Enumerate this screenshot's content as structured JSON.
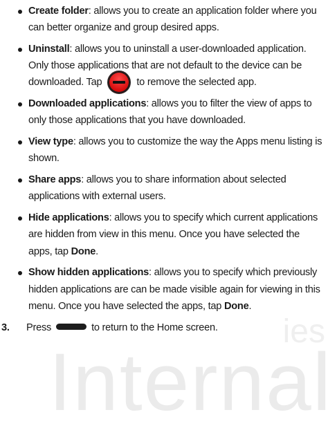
{
  "watermark": {
    "text": "Internal",
    "text2": "ies"
  },
  "bullets": [
    {
      "term": "Create folder",
      "desc": ": allows you to create an application folder where you can better organize and group desired apps."
    },
    {
      "term": "Uninstall",
      "desc_before": ": allows you to uninstall a user-downloaded application. Only those applications that are not default to the device can be downloaded. Tap",
      "icon": "remove-app-icon",
      "desc_after": "to remove the selected app."
    },
    {
      "term": "Downloaded applications",
      "desc": ": allows you to filter the view of apps to only those applications that you have downloaded."
    },
    {
      "term": "View type",
      "desc": ": allows you to customize the way the Apps menu listing is shown."
    },
    {
      "term": "Share apps",
      "desc": ": allows you to share information about selected applications with external users."
    },
    {
      "term": "Hide applications",
      "desc_before": ": allows you to specify which current applications are hidden from view in this menu. Once you have selected the apps, tap",
      "bold_end": "Done",
      "desc_after": "."
    },
    {
      "term": "Show hidden applications",
      "desc_before": ": allows you to specify which previously hidden applications are can be made visible again for viewing in this menu. Once you have selected the apps, tap",
      "bold_end": "Done",
      "desc_after": "."
    }
  ],
  "step": {
    "number": "3.",
    "before": "Press",
    "icon": "home-key-icon",
    "after": "to return to the Home screen."
  }
}
